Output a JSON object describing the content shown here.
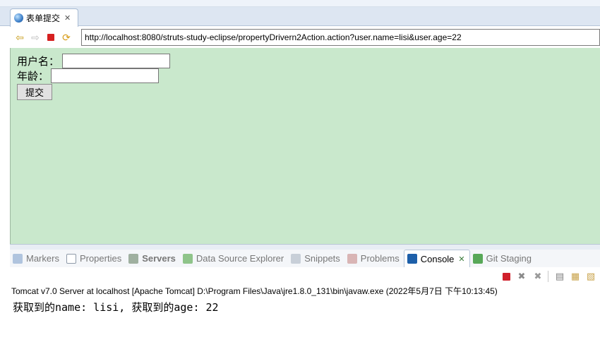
{
  "editor": {
    "tab_title": "表单提交",
    "tab_close": "✕"
  },
  "browser": {
    "url": "http://localhost:8080/struts-study-eclipse/propertyDrivern2Action.action?user.name=lisi&user.age=22"
  },
  "form": {
    "username_label": "用户名：",
    "age_label": "年龄：",
    "username_value": "",
    "age_value": "",
    "submit_label": "提交"
  },
  "views": {
    "tabs": [
      {
        "label": "Markers",
        "icon": "markers-icon"
      },
      {
        "label": "Properties",
        "icon": "properties-icon"
      },
      {
        "label": "Servers",
        "icon": "servers-icon"
      },
      {
        "label": "Data Source Explorer",
        "icon": "data-source-icon"
      },
      {
        "label": "Snippets",
        "icon": "snippets-icon"
      },
      {
        "label": "Problems",
        "icon": "problems-icon"
      },
      {
        "label": "Console",
        "icon": "console-icon",
        "active": true
      },
      {
        "label": "Git Staging",
        "icon": "git-staging-icon"
      }
    ],
    "console_close": "✕"
  },
  "console": {
    "header": "Tomcat v7.0 Server at localhost [Apache Tomcat] D:\\Program Files\\Java\\jre1.8.0_131\\bin\\javaw.exe (2022年5月7日 下午10:13:45)",
    "output": "获取到的name: lisi, 获取到的age: 22"
  },
  "colors": {
    "page_background": "#c9e8cc",
    "stop_red": "#d62020"
  }
}
